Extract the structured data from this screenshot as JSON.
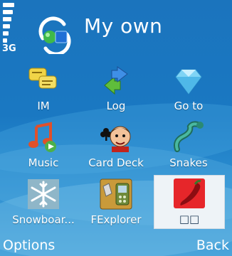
{
  "status": {
    "network": "3G"
  },
  "header": {
    "title": "My own"
  },
  "grid": {
    "items": [
      {
        "label": "IM",
        "icon": "im-icon"
      },
      {
        "label": "Log",
        "icon": "log-icon"
      },
      {
        "label": "Go to",
        "icon": "goto-icon"
      },
      {
        "label": "Music",
        "icon": "music-icon"
      },
      {
        "label": "Card Deck",
        "icon": "card-deck-icon"
      },
      {
        "label": "Snakes",
        "icon": "snakes-icon"
      },
      {
        "label": "Snowboar...",
        "icon": "snowboard-icon"
      },
      {
        "label": "FExplorer",
        "icon": "fexplorer-icon"
      },
      {
        "label": "□□",
        "icon": "chili-icon",
        "selected": true
      }
    ]
  },
  "softkeys": {
    "left": "Options",
    "right": "Back"
  }
}
